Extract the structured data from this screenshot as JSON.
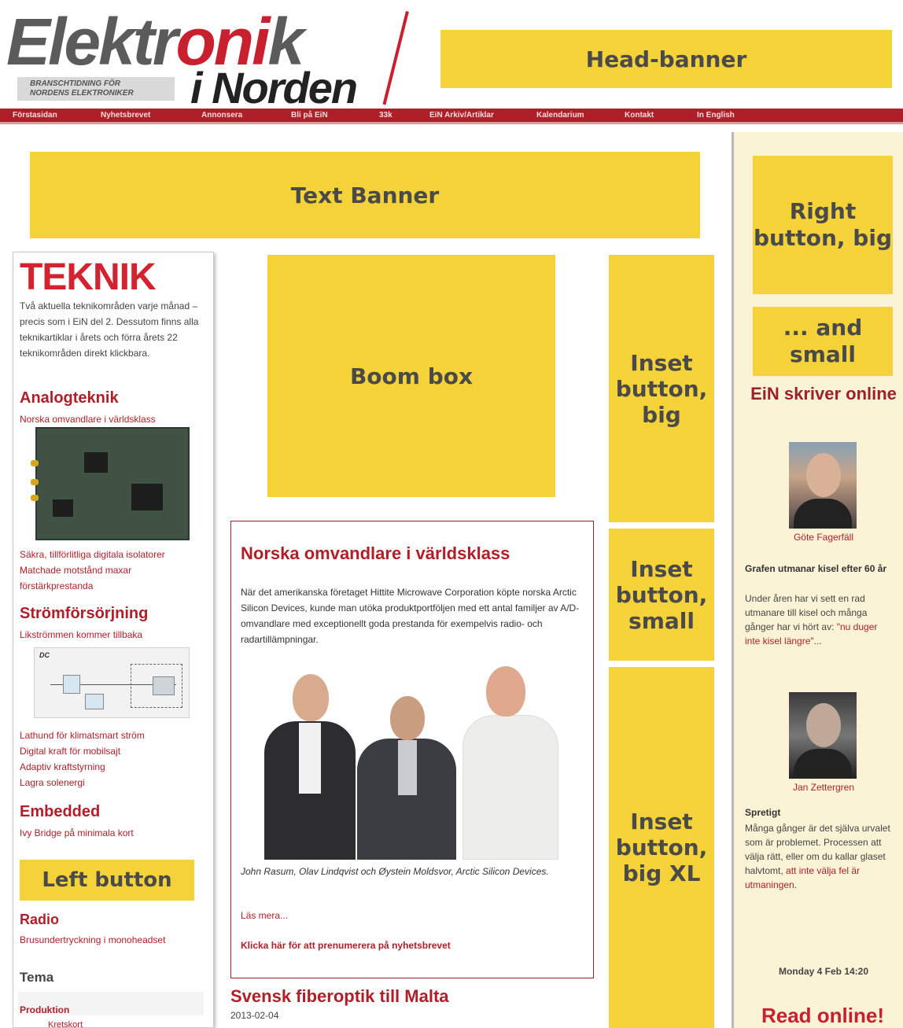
{
  "header": {
    "logo_word1_a": "Elektr",
    "logo_word1_b": "oni",
    "logo_word1_c": "k",
    "logo_word2": "i Norden",
    "logo_tagline_1": "BRANSCHTIDNING FÖR",
    "logo_tagline_2": "NORDENS ELEKTRONIKER",
    "head_banner": "Head-banner"
  },
  "nav": {
    "items": [
      "Förstasidan",
      "Nyhetsbrevet",
      "Annonsera",
      "Bli på EiN",
      "33k",
      "EiN Arkiv/Artiklar",
      "Kalendarium",
      "Kontakt",
      "In English"
    ]
  },
  "banners": {
    "text_banner": "Text Banner",
    "boom_box": "Boom box",
    "inset_big": "Inset button, big",
    "inset_small": "Inset button, small",
    "inset_xl": "Inset button, big XL",
    "right_big": "Right button, big",
    "right_small": "... and small",
    "left_button": "Left button"
  },
  "left": {
    "title": "TEKNIK",
    "intro": "Två aktuella teknikområden varje månad – precis som i EiN del 2. Dessutom finns alla teknikartiklar i årets och förra årets 22 teknikområden direkt klickbara.",
    "categories": [
      {
        "title": "Analogteknik",
        "lead": "Norska omvandlare i världsklass",
        "links": [
          "Säkra, tillförlitliga digitala isolatorer",
          "Matchade motstånd maxar",
          "förstärkprestanda"
        ]
      },
      {
        "title": "Strömförsörjning",
        "lead": "Likströmmen kommer tillbaka",
        "links": [
          "Lathund för klimatsmart ström",
          "Digital kraft för mobilsajt",
          "Adaptiv kraftstyrning",
          "Lagra solenergi"
        ]
      },
      {
        "title": "Embedded",
        "lead": "Ivy Bridge på minimala kort",
        "links": []
      },
      {
        "title": "Radio",
        "lead": "Brusundertryckning i monoheadset",
        "links": []
      }
    ],
    "diagram_label": "DC",
    "tema": "Tema",
    "tema_item": "Produktion",
    "tema_sub": "Kretskort"
  },
  "article": {
    "title": "Norska omvandlare i världsklass",
    "body": "När det amerikanska företaget Hittite Microwave Corporation köpte norska Arctic Silicon Devices, kunde man utöka produktportföljen med ett antal familjer av A/D-omvandlare med exceptionellt goda prestanda för exempelvis radio- och radartillämpningar.",
    "caption": "John Rasum, Olav Lindqvist och Øystein Moldsvor, Arctic Silicon Devices.",
    "read_more": "Läs mera...",
    "subscribe": "Klicka här för att prenumerera på nyhetsbrevet"
  },
  "next_article": {
    "title": "Svensk fiberoptik till Malta",
    "date": "2013-02-04"
  },
  "right": {
    "online_title": "EiN skriver online",
    "posts": [
      {
        "author": "Göte Fagerfäll",
        "title": "Grafen utmanar kisel efter 60 år",
        "text": "Under åren har vi sett en rad utmanare till kisel och många gånger har vi hört av: ",
        "text_red": "\"nu duger inte kisel längre\"..."
      },
      {
        "author": "Jan Zettergren",
        "title": "Spretigt",
        "text": "Många gånger är det själva urvalet som är problemet. Processen att välja rätt, eller om du kallar glaset halvtomt, ",
        "text_red": "att inte välja fel är utmaningen."
      }
    ],
    "timestamp": "Monday 4 Feb 14:20",
    "read_online": "Read online!"
  },
  "colors": {
    "banner_yellow": "#f5d237",
    "brand_red": "#b01e28",
    "right_column_bg": "#fbf3d6"
  }
}
